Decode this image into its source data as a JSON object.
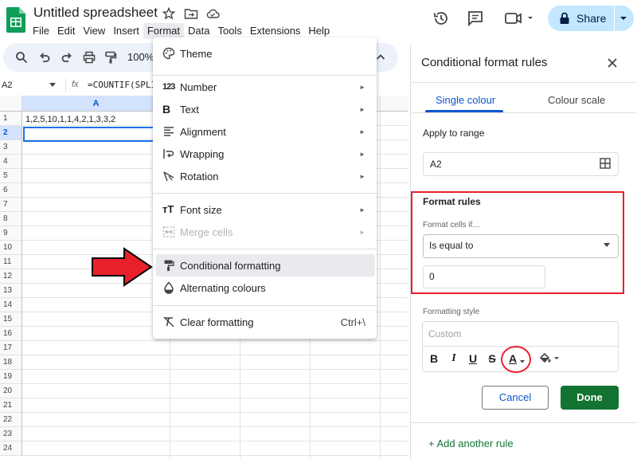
{
  "app": {
    "doc_title": "Untitled spreadsheet",
    "menu": [
      "File",
      "Edit",
      "View",
      "Insert",
      "Format",
      "Data",
      "Tools",
      "Extensions",
      "Help"
    ],
    "share_label": "Share",
    "zoom": "100%"
  },
  "formula_bar": {
    "name_box": "A2",
    "fx": "fx",
    "formula": "=COUNTIF(SPLI"
  },
  "grid": {
    "col_header": "A",
    "rows": [
      "1",
      "2",
      "3",
      "4",
      "5",
      "6",
      "7",
      "8",
      "9",
      "10",
      "11",
      "12",
      "13",
      "14",
      "15",
      "16",
      "17",
      "18",
      "19",
      "20",
      "21",
      "22",
      "23",
      "24"
    ],
    "cell_a1": "1,2,5,10,1,1,4,2,1,3,3,2"
  },
  "format_menu": {
    "items": [
      {
        "label": "Theme",
        "icon": "palette-icon"
      },
      {
        "label": "Number",
        "icon": "number-icon",
        "submenu": true
      },
      {
        "label": "Text",
        "icon": "bold-icon",
        "submenu": true
      },
      {
        "label": "Alignment",
        "icon": "align-icon",
        "submenu": true
      },
      {
        "label": "Wrapping",
        "icon": "wrap-icon",
        "submenu": true
      },
      {
        "label": "Rotation",
        "icon": "rotation-icon",
        "submenu": true
      },
      {
        "label": "Font size",
        "icon": "font-size-icon",
        "submenu": true
      },
      {
        "label": "Merge cells",
        "icon": "merge-icon",
        "submenu": true,
        "disabled": true
      },
      {
        "label": "Conditional formatting",
        "icon": "paint-roller-icon",
        "highlighted": true
      },
      {
        "label": "Alternating colours",
        "icon": "drop-icon"
      },
      {
        "label": "Clear formatting",
        "icon": "clear-format-icon",
        "shortcut": "Ctrl+\\"
      }
    ],
    "arrow_glyph": "►"
  },
  "panel": {
    "title": "Conditional format rules",
    "tab_single": "Single colour",
    "tab_scale": "Colour scale",
    "range_label": "Apply to range",
    "range_value": "A2",
    "rules_title": "Format rules",
    "condition_label": "Format cells if…",
    "condition_value": "Is equal to",
    "value": "0",
    "style_label": "Formatting style",
    "style_preview": "Custom",
    "style_buttons": [
      "B",
      "I",
      "U",
      "S"
    ],
    "text_color_glyph": "A",
    "cancel_label": "Cancel",
    "done_label": "Done",
    "add_rule": "+ Add another rule"
  },
  "colors": {
    "accent_blue": "#0b57d0",
    "done_green": "#137333",
    "annotation_red": "#e8202a"
  }
}
